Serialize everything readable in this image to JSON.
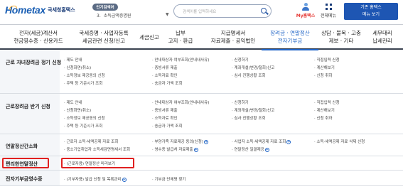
{
  "header": {
    "logo_main": "Hometax",
    "logo_sub": "국세청홈택스",
    "popular_label": "인기검색어",
    "popular_num": "3.",
    "popular_term": "소득금액증명원",
    "popular_arrow": "▼",
    "search_placeholder": "검색어를 입력하세요",
    "my_label": "My홈택스",
    "menu_label": "전체메뉴",
    "switch_line1": "기존 홈택스",
    "switch_line2": "메뉴 보기"
  },
  "nav": [
    {
      "l1": "전자(세금)계산서",
      "l2": "현금영수증 · 신용카드"
    },
    {
      "l1": "국세증명 · 사업자등록",
      "l2": "세금관련 신청/신고"
    },
    {
      "l1": "세금신고",
      "l2": ""
    },
    {
      "l1": "납부",
      "l2": "고지 · 환급"
    },
    {
      "l1": "지급명세서",
      "l2": "자료제출 · 공익법인"
    },
    {
      "l1": "장려금 · 연말정산",
      "l2": "전자기부금"
    },
    {
      "l1": "상담 · 불복 · 고충",
      "l2": "제보 · 기타"
    },
    {
      "l1": "세무대리",
      "l2": "납세관리"
    }
  ],
  "rows": [
    {
      "title": "근로 자녀장려금 정기 신청",
      "cols": [
        [
          "제도 안내",
          "신청화면(취소)",
          "소득정보 제공동의 신청",
          "주택 등 기준시가 조회"
        ],
        [
          "안내대상자 여부조회(안내내사유)",
          "증빙서류 제출",
          "소득자료 확인",
          "송금자 가액 조회"
        ],
        [
          "신청하기",
          "계좌개설(변경/철회)신고",
          "심사 진행상황 조회"
        ],
        [
          "직접입력 신청",
          "계산해보기",
          "신청 취하"
        ]
      ]
    },
    {
      "title": "근로장려금 반기 신청",
      "cols": [
        [
          "제도 안내",
          "신청화면(취소)",
          "소득정보 제공동의 신청",
          "주택 등 기준시가 조회"
        ],
        [
          "안내대상자 여부조회(안내내사유)",
          "증빙서류 제출",
          "소득자료 확인",
          "송금자 가액 조회"
        ],
        [
          "신청하기",
          "계좌개설(변경/철회)신고",
          "심사 진행상황 조회"
        ],
        [
          "직접입력 신청",
          "계산해보기",
          "신청 취하"
        ]
      ]
    },
    {
      "title": "연말정산간소화",
      "cols": [
        [
          "근로자 소득·세액공제 자료 조회",
          "중소기업취업자 소득세감면명세서 조회"
        ],
        [
          "부양가족 자료제공 동의(신청)",
          "영수증 발급처 자료제출"
        ],
        [
          "사업자 소득·세액공제 자료 조회",
          "연말정산 일괄제공"
        ],
        [
          "소득·세액공제 자료 삭제 신청"
        ]
      ]
    },
    {
      "title": "편리한연말정산",
      "cols": [
        [
          "(근로자용) 연말정산 미리보기"
        ]
      ]
    },
    {
      "title": "전자기부금영수증",
      "cols": [
        [
          "(기부자용) 발급 신청 및 목록관리"
        ],
        [
          "기부금 단체명 찾기"
        ]
      ]
    }
  ]
}
